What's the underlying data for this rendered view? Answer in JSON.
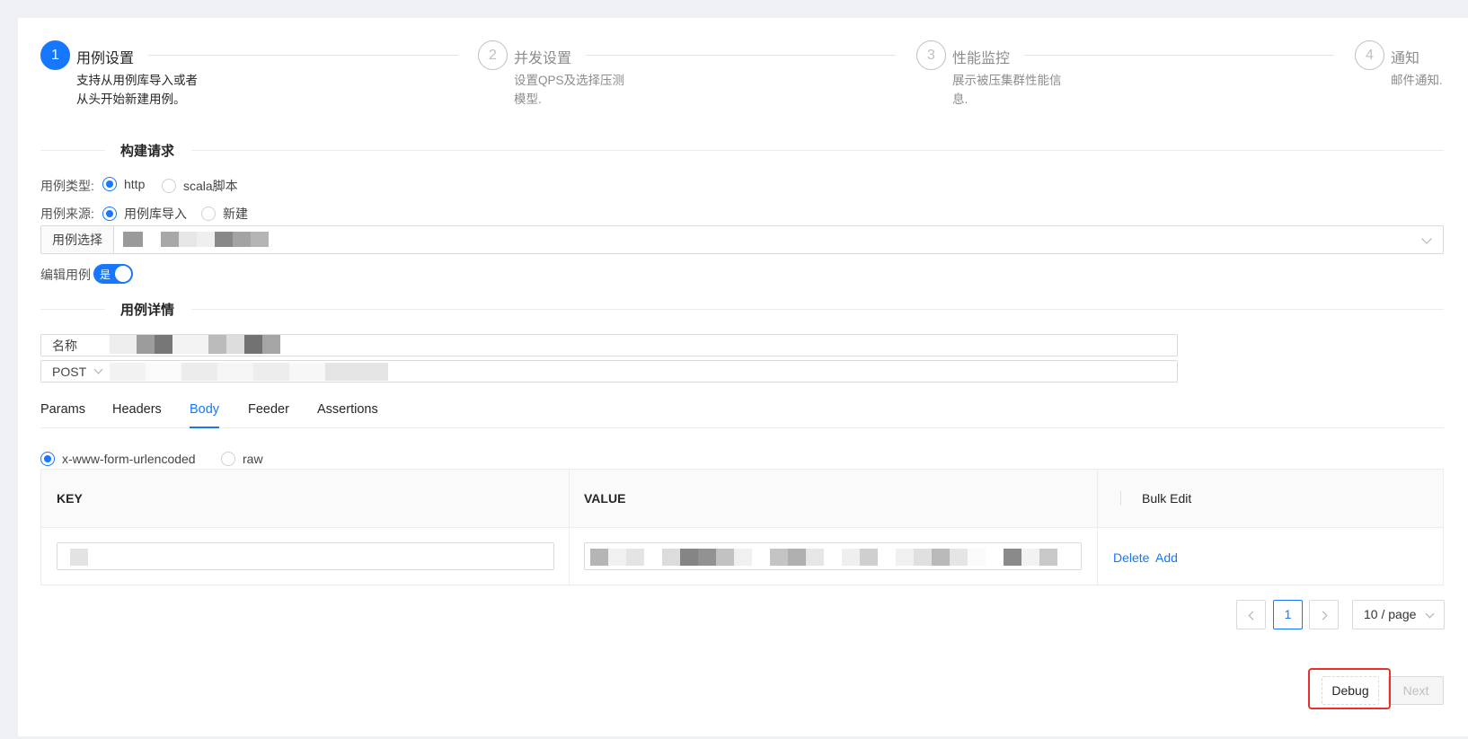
{
  "steps": [
    {
      "num": "1",
      "title": "用例设置",
      "desc1": "支持从用例库导入或者",
      "desc2": "从头开始新建用例。"
    },
    {
      "num": "2",
      "title": "并发设置",
      "desc1": "设置QPS及选择压测",
      "desc2": "模型."
    },
    {
      "num": "3",
      "title": "性能监控",
      "desc1": "展示被压集群性能信",
      "desc2": "息."
    },
    {
      "num": "4",
      "title": "通知",
      "desc1": "邮件通知."
    }
  ],
  "build": {
    "section_title": "构建请求",
    "case_type_label": "用例类型:",
    "case_type_options": [
      "http",
      "scala脚本"
    ],
    "case_source_label": "用例来源:",
    "case_source_options": [
      "用例库导入",
      "新建"
    ],
    "case_select_label": "用例选择",
    "edit_label": "编辑用例",
    "edit_switch_text": "是"
  },
  "detail": {
    "section_title": "用例详情",
    "name_label": "名称",
    "method": "POST"
  },
  "tabs": [
    "Params",
    "Headers",
    "Body",
    "Feeder",
    "Assertions"
  ],
  "active_tab": "Body",
  "body_types": [
    "x-www-form-urlencoded",
    "raw"
  ],
  "table": {
    "headers": [
      "KEY",
      "VALUE",
      "Bulk Edit"
    ],
    "row_actions": {
      "delete": "Delete",
      "add": "Add"
    }
  },
  "pagination": {
    "current_page": "1",
    "page_size": "10 / page"
  },
  "actions": {
    "debug": "Debug",
    "next": "Next"
  },
  "colors": {
    "primary": "#1677ff",
    "highlight": "#e6312e"
  }
}
